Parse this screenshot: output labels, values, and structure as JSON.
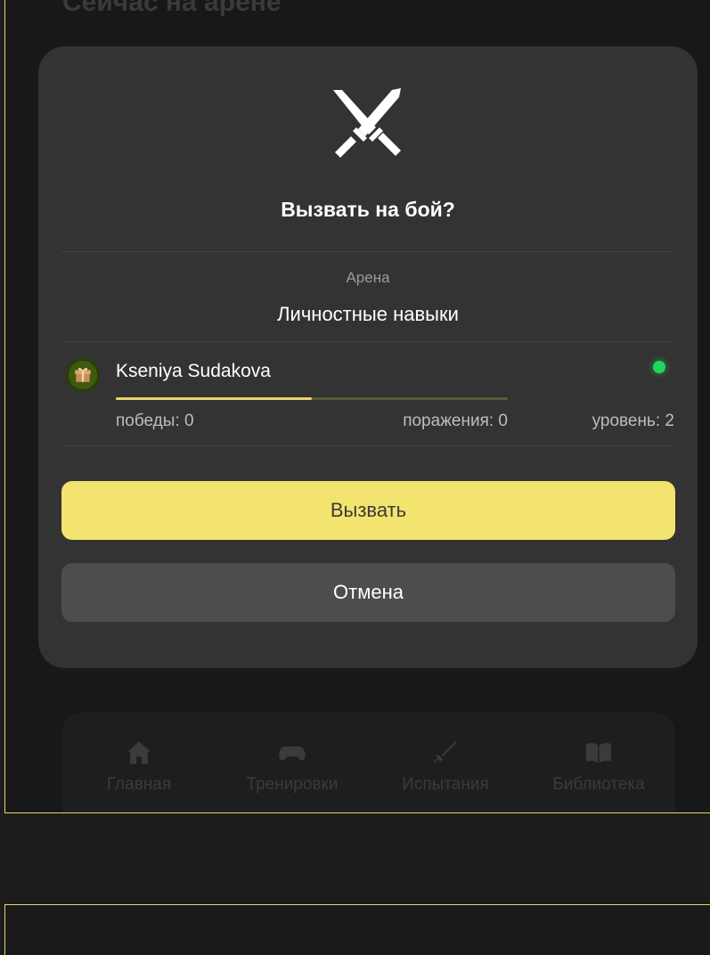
{
  "background": {
    "heading": "Сейчас на арене"
  },
  "nav": {
    "items": [
      {
        "label": "Главная",
        "icon": "home-icon"
      },
      {
        "label": "Тренировки",
        "icon": "gamepad-icon"
      },
      {
        "label": "Испытания",
        "icon": "sword-icon"
      },
      {
        "label": "Библиотека",
        "icon": "book-icon"
      }
    ]
  },
  "modal": {
    "icon": "crossed-swords-icon",
    "title": "Вызвать на бой?",
    "arena_label": "Арена",
    "arena_name": "Личностные навыки",
    "player": {
      "name": "Kseniya Sudakova",
      "online": true,
      "progress": 0.5,
      "wins": "победы: 0",
      "losses": "поражения: 0",
      "level": "уровень: 2"
    },
    "challenge_label": "Вызвать",
    "cancel_label": "Отмена"
  },
  "colors": {
    "accent": "#f3e36f",
    "modal_bg": "#333333",
    "page_bg": "#1c1c1c",
    "frame_border": "#e8d36a",
    "online": "#1fd65f"
  }
}
